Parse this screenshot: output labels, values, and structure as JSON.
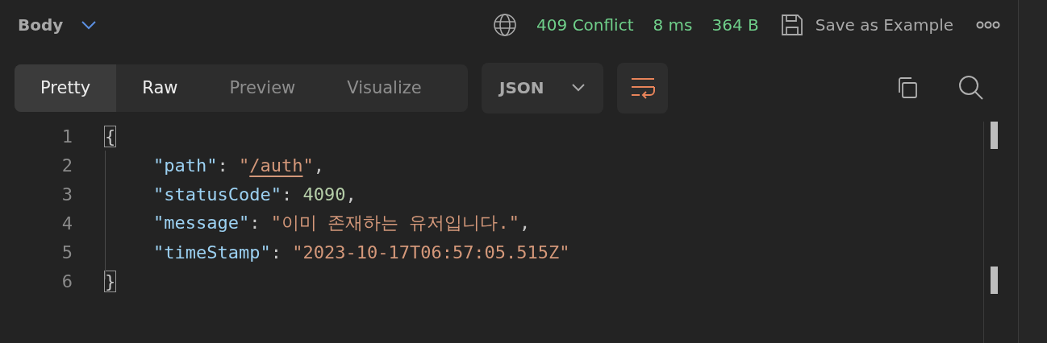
{
  "header": {
    "label": "Body",
    "status": "409 Conflict",
    "time": "8 ms",
    "size": "364 B",
    "save_label": "Save as Example"
  },
  "tabs": [
    {
      "label": "Pretty",
      "selected": true,
      "disabled": false
    },
    {
      "label": "Raw",
      "selected": false,
      "disabled": false
    },
    {
      "label": "Preview",
      "selected": false,
      "disabled": true
    },
    {
      "label": "Visualize",
      "selected": false,
      "disabled": true
    }
  ],
  "format": {
    "value": "JSON"
  },
  "code": {
    "lines": [
      {
        "number": "1",
        "tokens": [
          {
            "kind": "brace",
            "text": "{"
          }
        ],
        "children": [
          {
            "number": "2",
            "tokens": [
              {
                "kind": "key",
                "text": "\"path\""
              },
              {
                "kind": "punct",
                "text": ": "
              },
              {
                "kind": "string",
                "text": "\""
              },
              {
                "kind": "link",
                "text": "/auth"
              },
              {
                "kind": "string",
                "text": "\""
              },
              {
                "kind": "punct",
                "text": ","
              }
            ]
          },
          {
            "number": "3",
            "tokens": [
              {
                "kind": "key",
                "text": "\"statusCode\""
              },
              {
                "kind": "punct",
                "text": ": "
              },
              {
                "kind": "number",
                "text": "4090"
              },
              {
                "kind": "punct",
                "text": ","
              }
            ]
          },
          {
            "number": "4",
            "tokens": [
              {
                "kind": "key",
                "text": "\"message\""
              },
              {
                "kind": "punct",
                "text": ": "
              },
              {
                "kind": "string",
                "text": "\"이미 존재하는 유저입니다.\""
              },
              {
                "kind": "punct",
                "text": ","
              }
            ]
          },
          {
            "number": "5",
            "tokens": [
              {
                "kind": "key",
                "text": "\"timeStamp\""
              },
              {
                "kind": "punct",
                "text": ": "
              },
              {
                "kind": "string",
                "text": "\"2023-10-17T06:57:05.515Z\""
              }
            ]
          }
        ]
      },
      {
        "number": "6",
        "tokens": [
          {
            "kind": "brace",
            "text": "}"
          }
        ]
      }
    ]
  }
}
